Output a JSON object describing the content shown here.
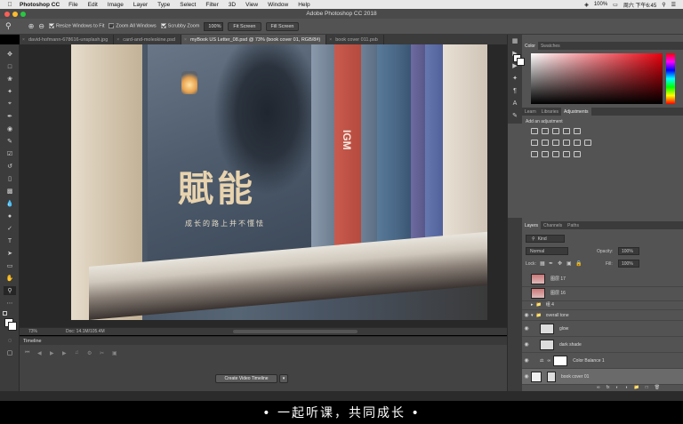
{
  "menubar": {
    "app_name": "Photoshop CC",
    "items": [
      "File",
      "Edit",
      "Image",
      "Layer",
      "Type",
      "Select",
      "Filter",
      "3D",
      "View",
      "Window",
      "Help"
    ],
    "battery": "100%",
    "clock": "周六 下午6:45"
  },
  "window": {
    "title": "Adobe Photoshop CC 2018"
  },
  "options": {
    "resize_windows": "Resize Windows to Fit",
    "zoom_all": "Zoom All Windows",
    "scrubby_zoom": "Scrubby Zoom",
    "zoom_value": "100%",
    "fit_screen": "Fit Screen",
    "fill_screen": "Fill Screen"
  },
  "tabs": [
    {
      "label": "david-hofmann-678616-unsplash.jpg"
    },
    {
      "label": "card-and-moleskine.psd"
    },
    {
      "label": "myBook US Letter_08.psd @ 73% (book cover 01, RGB/8#)"
    },
    {
      "label": "book cover 011.psb"
    }
  ],
  "canvas": {
    "cover_title": "賦能",
    "cover_subtitle": "成长的路上并不懂怯",
    "spine_text": "IGM"
  },
  "status": {
    "zoom": "73%",
    "doc": "Doc: 14.1M/105.4M"
  },
  "timeline": {
    "title": "Timeline",
    "create_button": "Create Video Timeline"
  },
  "panels": {
    "color_tabs": [
      "Color",
      "Swatches"
    ],
    "adjust_tabs": [
      "Learn",
      "Libraries",
      "Adjustments"
    ],
    "add_adjustment": "Add an adjustment",
    "layer_tabs": [
      "Layers",
      "Channels",
      "Paths"
    ],
    "kind": "Kind",
    "blend_mode": "Normal",
    "opacity_label": "Opacity:",
    "opacity_value": "100%",
    "lock_label": "Lock:",
    "fill_label": "Fill:",
    "fill_value": "100%",
    "layers": [
      {
        "name": "图层 17"
      },
      {
        "name": "图层 16"
      },
      {
        "name": "组 4"
      },
      {
        "name": "overall tone"
      },
      {
        "name": "glow"
      },
      {
        "name": "dark shade"
      },
      {
        "name": "Color Balance 1"
      },
      {
        "name": "book cover 01"
      }
    ]
  },
  "subtitle": "• 一起听课，共同成长 •"
}
